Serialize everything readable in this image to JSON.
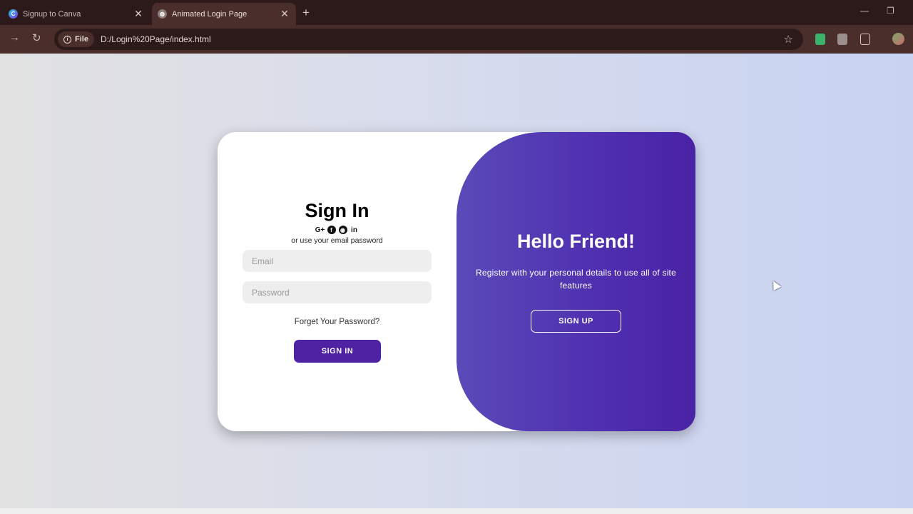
{
  "browser": {
    "tabs": [
      {
        "title": "Signup to Canva",
        "active": false
      },
      {
        "title": "Animated Login Page",
        "active": true
      }
    ],
    "chip_label": "File",
    "url": "D:/Login%20Page/index.html"
  },
  "signin": {
    "title": "Sign In",
    "social_icons": [
      "google-plus-icon",
      "facebook-icon",
      "github-icon",
      "linkedin-icon"
    ],
    "social_glyphs": {
      "google": "G+",
      "facebook": "f",
      "github": "◉",
      "linkedin": "in"
    },
    "subtitle": "or use your email password",
    "email_placeholder": "Email",
    "password_placeholder": "Password",
    "forgot": "Forget Your Password?",
    "button": "SIGN IN"
  },
  "panel": {
    "title": "Hello Friend!",
    "text": "Register with your personal details to use all of site features",
    "button": "SIGN UP"
  },
  "colors": {
    "accent": "#4f21a3",
    "panel_gradient_start": "#5a4ab8",
    "panel_gradient_end": "#4a22a6"
  }
}
